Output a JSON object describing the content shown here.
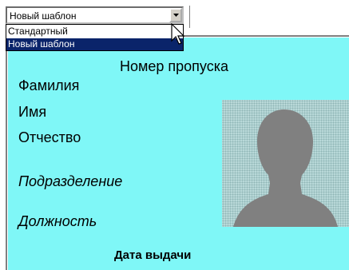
{
  "template_select": {
    "value": "Новый шаблон",
    "options": [
      "Стандартный",
      "Новый шаблон"
    ]
  },
  "card": {
    "title": "Номер пропуска",
    "last_name_label": "Фамилия",
    "first_name_label": "Имя",
    "patronymic_label": "Отчество",
    "department_label": "Подразделение",
    "position_label": "Должность",
    "issue_date_label": "Дата выдачи"
  },
  "icons": {
    "dropdown_arrow": "chevron-down-icon",
    "cursor": "mouse-pointer-icon",
    "photo": "person-silhouette-icon"
  },
  "colors": {
    "card_background": "#7ff7f7",
    "selection": "#0a246a",
    "silhouette": "#808080"
  }
}
